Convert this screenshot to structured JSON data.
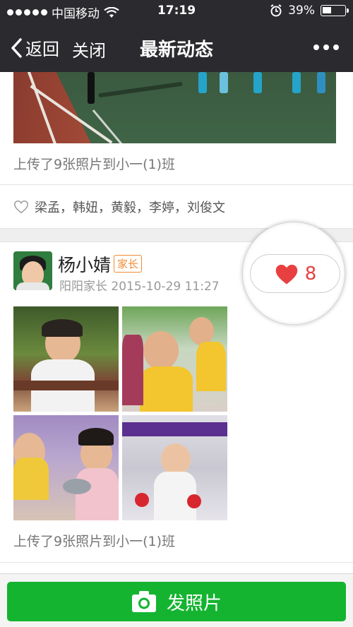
{
  "status_bar": {
    "carrier": "中国移动",
    "time": "17:19",
    "battery_percent": "39%",
    "battery_level": 0.39,
    "icons": [
      "signal-dots-icon",
      "wifi-icon",
      "alarm-icon",
      "battery-icon"
    ]
  },
  "nav": {
    "back_label": "返回",
    "close_label": "关闭",
    "title": "最新动态",
    "more_icon": "more-dots-icon"
  },
  "posts": [
    {
      "caption": "上传了9张照片到小一(1)班",
      "likers": "梁孟，韩妞，黄毅，李婷，刘俊文"
    },
    {
      "author": "杨小婧",
      "role_badge": "家长",
      "meta": "阳阳家长 2015-10-29 11:27",
      "like_count": "8",
      "caption": "上传了9张照片到小一(1)班"
    }
  ],
  "bottom": {
    "upload_label": "发照片",
    "upload_icon": "camera-icon"
  },
  "colors": {
    "bar_bg": "#2b2b2f",
    "accent_green": "#14b430",
    "like_red": "#e84040",
    "badge_orange": "#f08a34"
  }
}
